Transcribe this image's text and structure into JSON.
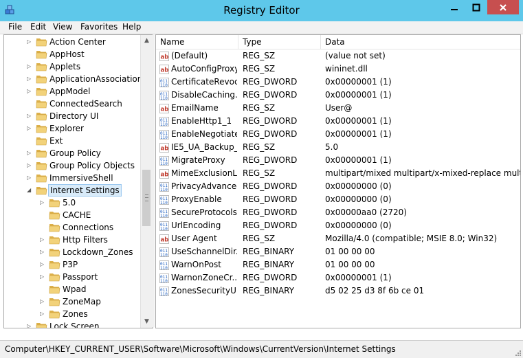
{
  "window": {
    "title": "Registry Editor",
    "icon": "registry-cubes-icon"
  },
  "menu": [
    "File",
    "Edit",
    "View",
    "Favorites",
    "Help"
  ],
  "tree": [
    {
      "label": "Action Center",
      "indent": 0,
      "expander": true
    },
    {
      "label": "AppHost",
      "indent": 0,
      "expander": false
    },
    {
      "label": "Applets",
      "indent": 0,
      "expander": true
    },
    {
      "label": "ApplicationAssociationT",
      "indent": 0,
      "expander": true
    },
    {
      "label": "AppModel",
      "indent": 0,
      "expander": true
    },
    {
      "label": "ConnectedSearch",
      "indent": 0,
      "expander": false
    },
    {
      "label": "Directory UI",
      "indent": 0,
      "expander": true
    },
    {
      "label": "Explorer",
      "indent": 0,
      "expander": true
    },
    {
      "label": "Ext",
      "indent": 0,
      "expander": false
    },
    {
      "label": "Group Policy",
      "indent": 0,
      "expander": true
    },
    {
      "label": "Group Policy Objects",
      "indent": 0,
      "expander": true
    },
    {
      "label": "ImmersiveShell",
      "indent": 0,
      "expander": true
    },
    {
      "label": "Internet Settings",
      "indent": 0,
      "expander": "open",
      "selected": true
    },
    {
      "label": "5.0",
      "indent": 1,
      "expander": true
    },
    {
      "label": "CACHE",
      "indent": 1,
      "expander": false
    },
    {
      "label": "Connections",
      "indent": 1,
      "expander": false
    },
    {
      "label": "Http Filters",
      "indent": 1,
      "expander": true
    },
    {
      "label": "Lockdown_Zones",
      "indent": 1,
      "expander": true
    },
    {
      "label": "P3P",
      "indent": 1,
      "expander": true
    },
    {
      "label": "Passport",
      "indent": 1,
      "expander": true
    },
    {
      "label": "Wpad",
      "indent": 1,
      "expander": false
    },
    {
      "label": "ZoneMap",
      "indent": 1,
      "expander": true
    },
    {
      "label": "Zones",
      "indent": 1,
      "expander": true
    },
    {
      "label": "Lock Screen",
      "indent": 0,
      "expander": true
    }
  ],
  "columns": {
    "name": "Name",
    "type": "Type",
    "data": "Data"
  },
  "values": [
    {
      "name": "(Default)",
      "type": "REG_SZ",
      "data": "(value not set)",
      "icon": "string"
    },
    {
      "name": "AutoConfigProxy",
      "type": "REG_SZ",
      "data": "wininet.dll",
      "icon": "string"
    },
    {
      "name": "CertificateRevoc...",
      "type": "REG_DWORD",
      "data": "0x00000001 (1)",
      "icon": "binary"
    },
    {
      "name": "DisableCaching...",
      "type": "REG_DWORD",
      "data": "0x00000001 (1)",
      "icon": "binary"
    },
    {
      "name": "EmailName",
      "type": "REG_SZ",
      "data": "User@",
      "icon": "string"
    },
    {
      "name": "EnableHttp1_1",
      "type": "REG_DWORD",
      "data": "0x00000001 (1)",
      "icon": "binary"
    },
    {
      "name": "EnableNegotiate",
      "type": "REG_DWORD",
      "data": "0x00000001 (1)",
      "icon": "binary"
    },
    {
      "name": "IE5_UA_Backup_...",
      "type": "REG_SZ",
      "data": "5.0",
      "icon": "string"
    },
    {
      "name": "MigrateProxy",
      "type": "REG_DWORD",
      "data": "0x00000001 (1)",
      "icon": "binary"
    },
    {
      "name": "MimeExclusionL...",
      "type": "REG_SZ",
      "data": "multipart/mixed multipart/x-mixed-replace multip...",
      "icon": "string"
    },
    {
      "name": "PrivacyAdvanced",
      "type": "REG_DWORD",
      "data": "0x00000000 (0)",
      "icon": "binary"
    },
    {
      "name": "ProxyEnable",
      "type": "REG_DWORD",
      "data": "0x00000000 (0)",
      "icon": "binary"
    },
    {
      "name": "SecureProtocols",
      "type": "REG_DWORD",
      "data": "0x00000aa0 (2720)",
      "icon": "binary"
    },
    {
      "name": "UrlEncoding",
      "type": "REG_DWORD",
      "data": "0x00000000 (0)",
      "icon": "binary"
    },
    {
      "name": "User Agent",
      "type": "REG_SZ",
      "data": "Mozilla/4.0 (compatible; MSIE 8.0; Win32)",
      "icon": "string"
    },
    {
      "name": "UseSchannelDir...",
      "type": "REG_BINARY",
      "data": "01 00 00 00",
      "icon": "binary"
    },
    {
      "name": "WarnOnPost",
      "type": "REG_BINARY",
      "data": "01 00 00 00",
      "icon": "binary"
    },
    {
      "name": "WarnonZoneCr...",
      "type": "REG_DWORD",
      "data": "0x00000001 (1)",
      "icon": "binary"
    },
    {
      "name": "ZonesSecurityU...",
      "type": "REG_BINARY",
      "data": "d5 02 25 d3 8f 6b ce 01",
      "icon": "binary"
    }
  ],
  "status": {
    "path": "Computer\\HKEY_CURRENT_USER\\Software\\Microsoft\\Windows\\CurrentVersion\\Internet Settings"
  },
  "colors": {
    "titlebar": "#5ec8ea",
    "close": "#c74f4f",
    "folder": "#e8c25a",
    "selection": "#d9ebf9"
  }
}
